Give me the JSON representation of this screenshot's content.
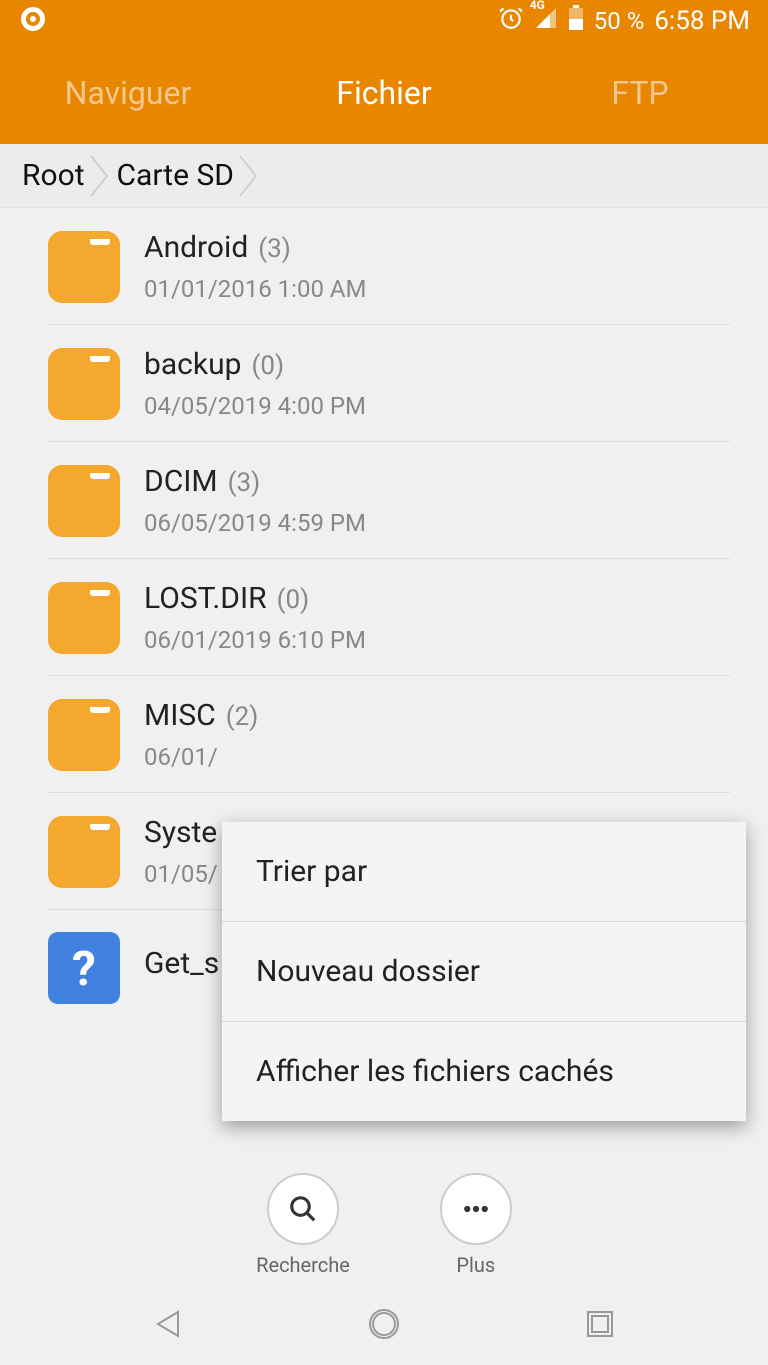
{
  "status_bar": {
    "network": "4G",
    "battery_pct": "50 %",
    "time": "6:58 PM"
  },
  "tabs": {
    "naviguer": "Naviguer",
    "fichier": "Fichier",
    "ftp": "FTP"
  },
  "breadcrumb": {
    "root": "Root",
    "sdcard": "Carte SD"
  },
  "items": [
    {
      "name": "Android",
      "count": "(3)",
      "date": "01/01/2016 1:00 AM",
      "type": "folder"
    },
    {
      "name": "backup",
      "count": "(0)",
      "date": "04/05/2019 4:00 PM",
      "type": "folder"
    },
    {
      "name": "DCIM",
      "count": "(3)",
      "date": "06/05/2019 4:59 PM",
      "type": "folder"
    },
    {
      "name": "LOST.DIR",
      "count": "(0)",
      "date": "06/01/2019 6:10 PM",
      "type": "folder"
    },
    {
      "name": "MISC",
      "count": "(2)",
      "date": "06/01/",
      "type": "folder"
    },
    {
      "name": "Syste",
      "count": "",
      "date": "01/05/",
      "type": "folder"
    },
    {
      "name": "Get_s",
      "count": "",
      "date": "",
      "type": "unknown"
    }
  ],
  "popup": {
    "sort": "Trier par",
    "new_folder": "Nouveau dossier",
    "show_hidden": "Afficher les fichiers cachés"
  },
  "actions": {
    "search": "Recherche",
    "more": "Plus"
  },
  "unknown_mark": "?"
}
